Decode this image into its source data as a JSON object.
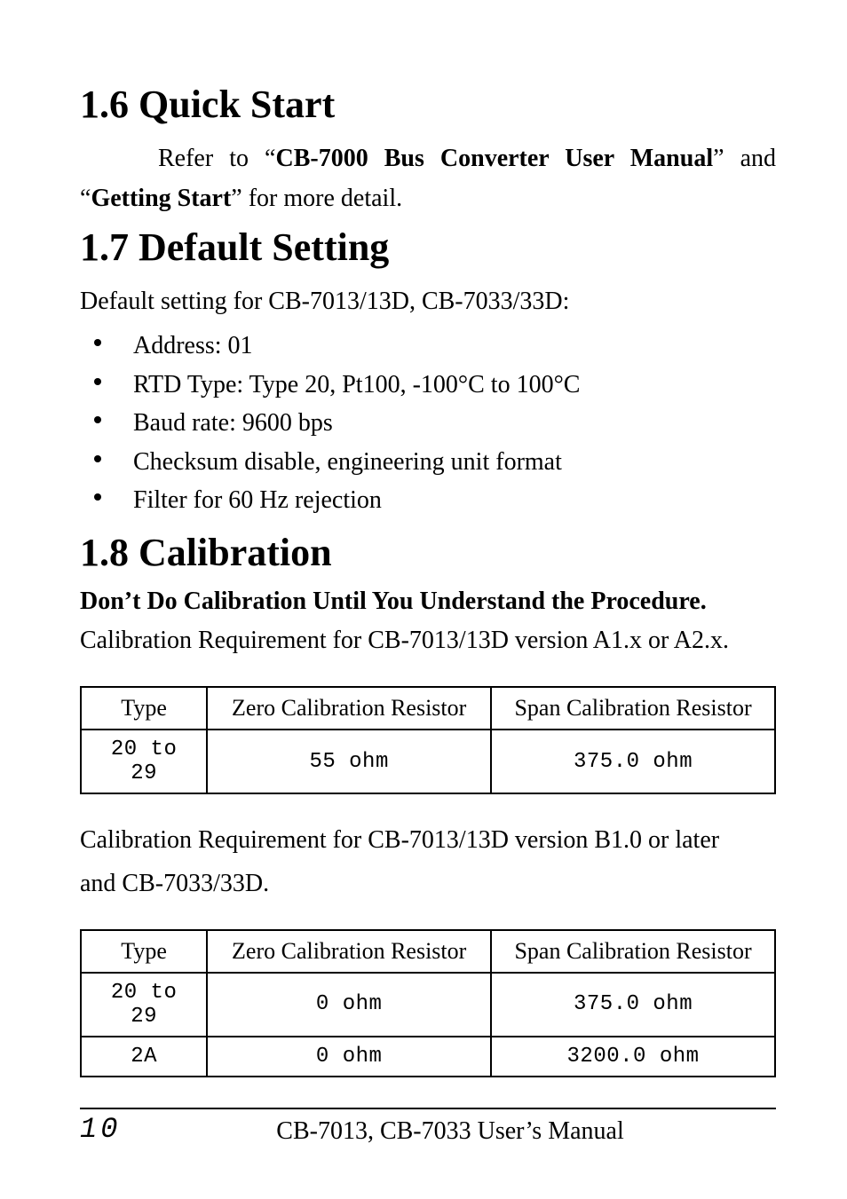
{
  "sections": {
    "quick_start": {
      "heading": "1.6 Quick Start",
      "para_prefix": "Refer to “",
      "para_bold1": "CB-7000 Bus Converter User Manual",
      "para_mid": "” and “",
      "para_bold2": "Getting Start",
      "para_suffix": "” for more detail."
    },
    "default_setting": {
      "heading": "1.7 Default Setting",
      "intro": "Default setting for CB-7013/13D, CB-7033/33D:",
      "items": [
        "Address: 01",
        "RTD Type: Type 20, Pt100, -100°C to 100°C",
        "Baud rate: 9600 bps",
        "Checksum disable, engineering unit format",
        "Filter for 60 Hz rejection"
      ]
    },
    "calibration": {
      "heading": "1.8 Calibration",
      "warning": "Don’t Do Calibration Until You Understand the Procedure.",
      "req1": "Calibration Requirement for CB-7013/13D version A1.x or A2.x.",
      "req2_line1": "Calibration Requirement for CB-7013/13D version B1.0 or later",
      "req2_line2": "and  CB-7033/33D."
    }
  },
  "table_headers": {
    "type": "Type",
    "zero": "Zero Calibration Resistor",
    "span": "Span Calibration Resistor"
  },
  "table1": {
    "rows": [
      {
        "type": "20 to 29",
        "zero": "55 ohm",
        "span": "375.0 ohm"
      }
    ]
  },
  "table2": {
    "rows": [
      {
        "type": "20 to 29",
        "zero": "0 ohm",
        "span": "375.0 ohm"
      },
      {
        "type": "2A",
        "zero": "0 ohm",
        "span": "3200.0 ohm"
      }
    ]
  },
  "footer": {
    "page_number": "10",
    "title": "CB-7013, CB-7033 User’s Manual"
  }
}
